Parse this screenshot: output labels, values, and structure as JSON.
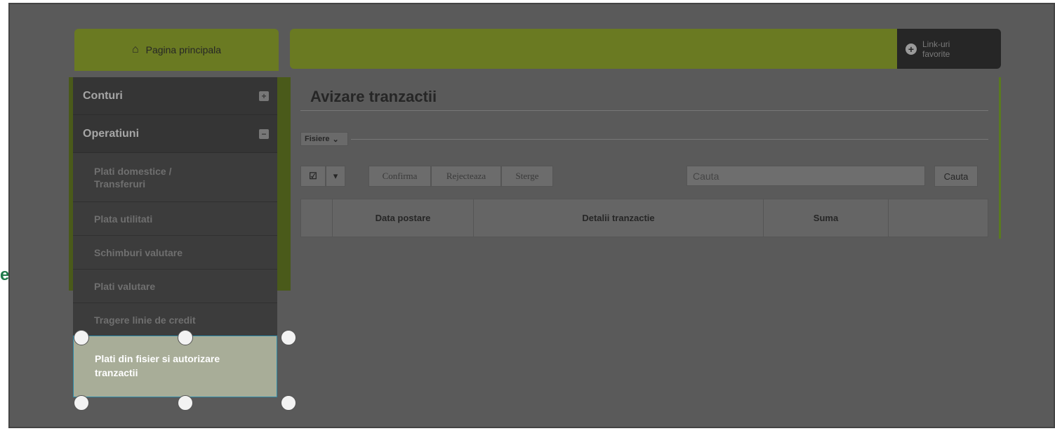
{
  "stray_char": "e",
  "sidebar": {
    "home_label": "Pagina principala",
    "sections": [
      {
        "label": "Conturi",
        "toggle": "+"
      },
      {
        "label": "Operatiuni",
        "toggle": "−"
      }
    ],
    "items": [
      {
        "label": "Plati domestice / Transferuri"
      },
      {
        "label": "Plata utilitati"
      },
      {
        "label": "Schimburi valutare"
      },
      {
        "label": "Plati valutare"
      },
      {
        "label": "Tragere linie de credit"
      },
      {
        "label": "Plati din fisier si autorizare tranzactii"
      }
    ]
  },
  "favorites": {
    "label_line1": "Link-uri",
    "label_line2": "favorite",
    "icon": "plus-circle-icon"
  },
  "main": {
    "title": "Avizare tranzactii",
    "files_button": "Fisiere",
    "toolbar": {
      "check_icon": "check-square-icon",
      "dropdown_icon": "caret-down-icon",
      "confirm": "Confirma",
      "reject": "Rejecteaza",
      "delete": "Sterge",
      "search_placeholder": "Cauta",
      "search_button": "Cauta"
    },
    "table_headers": [
      "",
      "Data postare",
      "Detalii tranzactie",
      "Suma",
      ""
    ]
  },
  "colors": {
    "accent_green": "#6a7a22",
    "overlay": "#5a5a5a"
  }
}
